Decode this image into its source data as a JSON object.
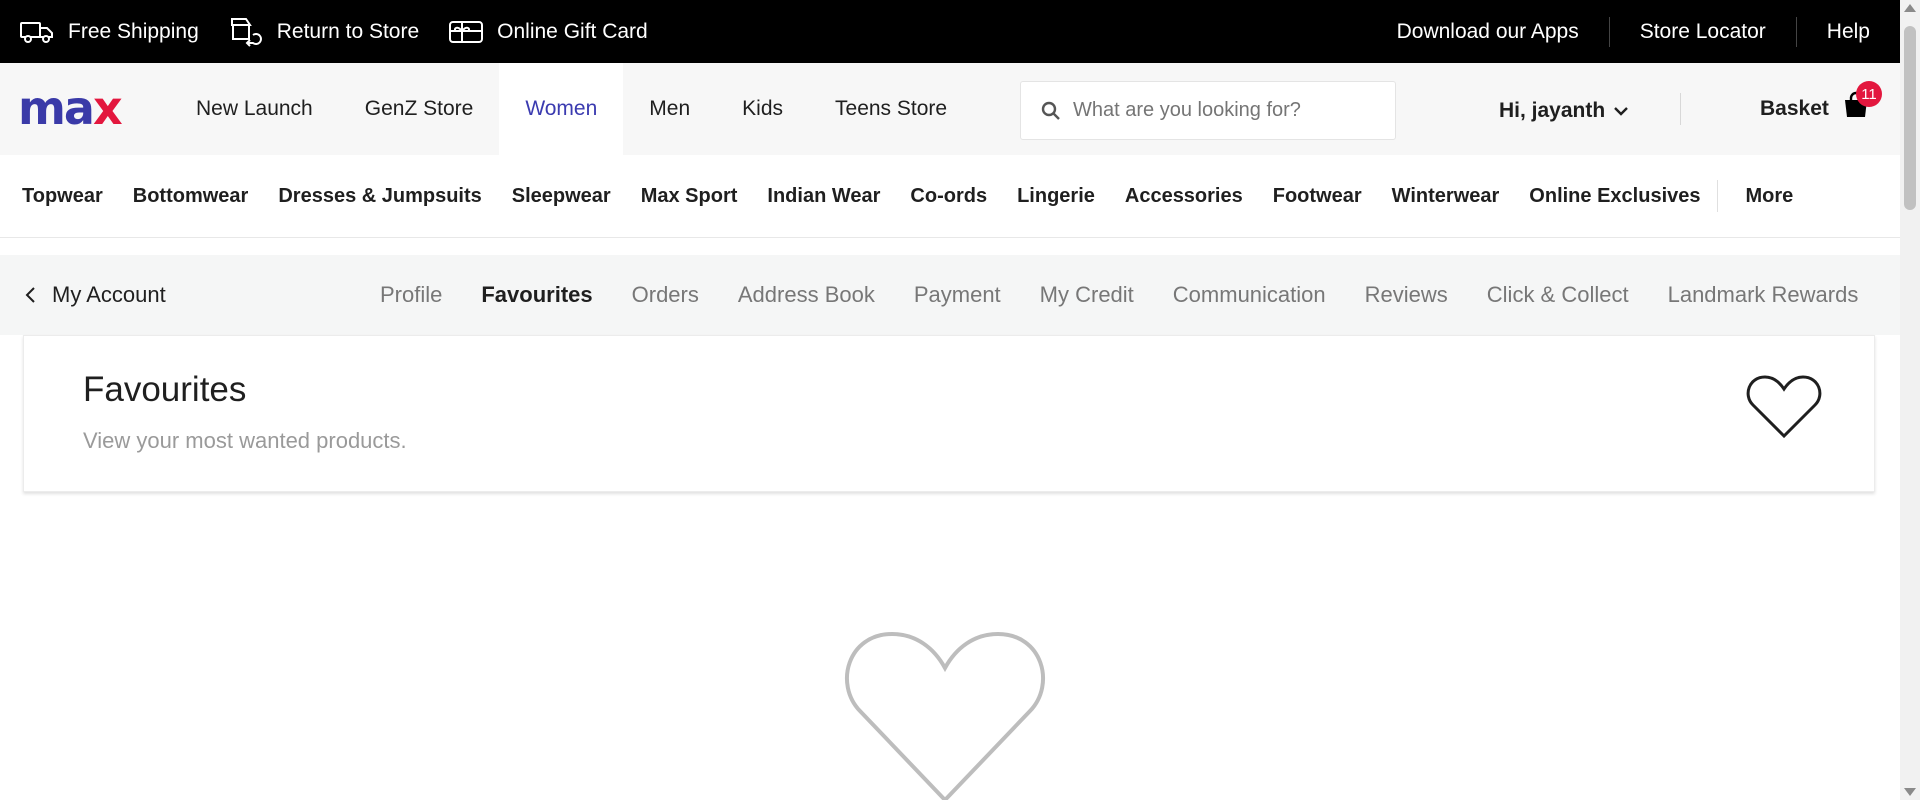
{
  "topbar": {
    "left_items": [
      {
        "label": "Free Shipping",
        "icon": "truck-icon"
      },
      {
        "label": "Return to Store",
        "icon": "return-icon"
      },
      {
        "label": "Online Gift Card",
        "icon": "gift-card-icon"
      }
    ],
    "right_links": [
      "Download our Apps",
      "Store Locator",
      "Help"
    ]
  },
  "header": {
    "logo": "max",
    "nav": [
      {
        "label": "New Launch",
        "active": false
      },
      {
        "label": "GenZ Store",
        "active": false
      },
      {
        "label": "Women",
        "active": true
      },
      {
        "label": "Men",
        "active": false
      },
      {
        "label": "Kids",
        "active": false
      },
      {
        "label": "Teens Store",
        "active": false
      }
    ],
    "search_placeholder": "What are you looking for?",
    "user_greeting": "Hi, jayanth",
    "basket_label": "Basket",
    "basket_count": "11"
  },
  "categories": [
    "Topwear",
    "Bottomwear",
    "Dresses & Jumpsuits",
    "Sleepwear",
    "Max Sport",
    "Indian Wear",
    "Co-ords",
    "Lingerie",
    "Accessories",
    "Footwear",
    "Winterwear",
    "Online Exclusives",
    "More"
  ],
  "account": {
    "back_label": "My Account",
    "tabs": [
      {
        "label": "Profile",
        "active": false
      },
      {
        "label": "Favourites",
        "active": true
      },
      {
        "label": "Orders",
        "active": false
      },
      {
        "label": "Address Book",
        "active": false
      },
      {
        "label": "Payment",
        "active": false
      },
      {
        "label": "My Credit",
        "active": false
      },
      {
        "label": "Communication",
        "active": false
      },
      {
        "label": "Reviews",
        "active": false
      },
      {
        "label": "Click & Collect",
        "active": false
      },
      {
        "label": "Landmark Rewards",
        "active": false
      }
    ]
  },
  "favourites": {
    "title": "Favourites",
    "subtitle": "View your most wanted products."
  },
  "colors": {
    "brand_blue": "#3a3aa8",
    "brand_red": "#e3173e",
    "active_nav": "#3b3bb0",
    "badge": "#e3173e"
  }
}
